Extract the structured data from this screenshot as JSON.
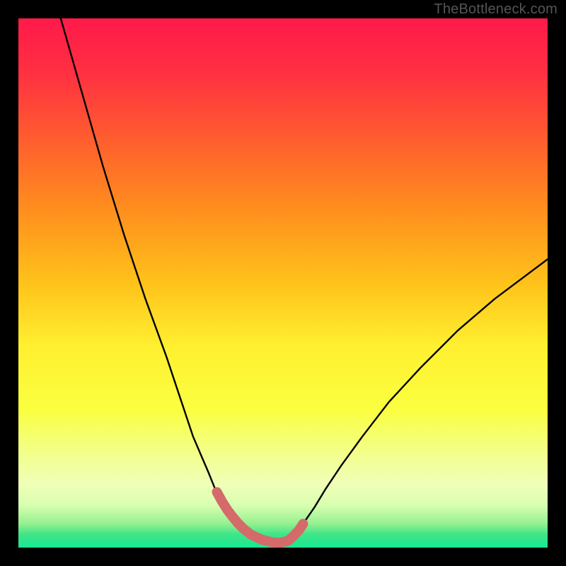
{
  "watermark": "TheBottleneck.com",
  "chart_data": {
    "type": "line",
    "title": "",
    "xlabel": "",
    "ylabel": "",
    "xlim": [
      0,
      100
    ],
    "ylim": [
      0,
      100
    ],
    "grid": false,
    "legend": false,
    "series": [
      {
        "name": "curve-left",
        "x": [
          8,
          12,
          16,
          20,
          24,
          28,
          31,
          33,
          34.5,
          36,
          37,
          38,
          39,
          40,
          41,
          42,
          43,
          44,
          45,
          47,
          49
        ],
        "y": [
          100,
          86,
          72,
          59,
          47,
          36,
          27,
          21,
          17.5,
          14,
          11.5,
          9.5,
          7.8,
          6.3,
          5.0,
          3.9,
          3.0,
          2.3,
          1.7,
          1.0,
          0.7
        ]
      },
      {
        "name": "curve-right",
        "x": [
          49,
          51,
          52,
          53,
          54,
          56,
          58,
          61,
          65,
          70,
          76,
          83,
          90,
          96,
          100
        ],
        "y": [
          0.7,
          1.5,
          2.4,
          3.5,
          4.8,
          7.7,
          11,
          15.5,
          21,
          27.5,
          34,
          41,
          47,
          51.5,
          54.5
        ]
      },
      {
        "name": "valley-highlight",
        "x": [
          37.5,
          38.5,
          39.5,
          40.5,
          41.5,
          42.5,
          44,
          46,
          48,
          49.5,
          51,
          52,
          53,
          53.8
        ],
        "y": [
          10.5,
          8.7,
          7.1,
          5.8,
          4.6,
          3.6,
          2.4,
          1.5,
          1.0,
          0.9,
          1.3,
          2.2,
          3.3,
          4.5
        ]
      }
    ],
    "gradient_stops": [
      {
        "pos": 0.0,
        "color": "#ff1a4a"
      },
      {
        "pos": 0.1,
        "color": "#ff2f42"
      },
      {
        "pos": 0.22,
        "color": "#ff5a30"
      },
      {
        "pos": 0.35,
        "color": "#ff8a1f"
      },
      {
        "pos": 0.5,
        "color": "#ffc21a"
      },
      {
        "pos": 0.62,
        "color": "#fff030"
      },
      {
        "pos": 0.74,
        "color": "#faff40"
      },
      {
        "pos": 0.82,
        "color": "#f2ff8a"
      },
      {
        "pos": 0.88,
        "color": "#f0ffb8"
      },
      {
        "pos": 0.92,
        "color": "#d8ffb0"
      },
      {
        "pos": 0.955,
        "color": "#94f090"
      },
      {
        "pos": 0.975,
        "color": "#3fe587"
      },
      {
        "pos": 1.0,
        "color": "#18e892"
      }
    ],
    "highlight_color": "#d46a6a",
    "curve_color": "#000000"
  }
}
